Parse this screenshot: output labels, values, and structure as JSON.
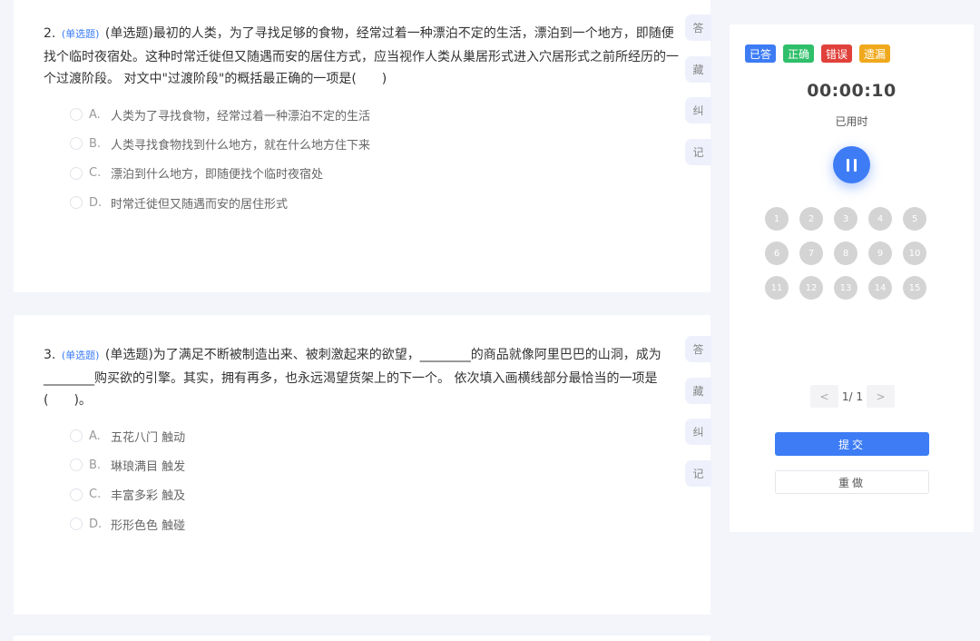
{
  "questions": [
    {
      "num": "2.",
      "type": "(单选题)",
      "text": "(单选题)最初的人类，为了寻找足够的食物，经常过着一种漂泊不定的生活，漂泊到一个地方，即随便找个临时夜宿处。这种时常迁徙但又随遇而安的居住方式，应当视作人类从巢居形式进入穴居形式之前所经历的一个过渡阶段。 对文中\"过渡阶段\"的概括最正确的一项是(　　)",
      "options": [
        {
          "letter": "A.",
          "text": "人类为了寻找食物，经常过着一种漂泊不定的生活"
        },
        {
          "letter": "B.",
          "text": "人类寻找食物找到什么地方，就在什么地方住下来"
        },
        {
          "letter": "C.",
          "text": "漂泊到什么地方，即随便找个临时夜宿处"
        },
        {
          "letter": "D.",
          "text": "时常迁徙但又随遇而安的居住形式"
        }
      ],
      "side": [
        "答",
        "藏",
        "纠",
        "记"
      ]
    },
    {
      "num": "3.",
      "type": "(单选题)",
      "text": "(单选题)为了满足不断被制造出来、被刺激起来的欲望，________的商品就像阿里巴巴的山洞，成为________购买欲的引擎。其实，拥有再多，也永远渴望货架上的下一个。 依次填入画横线部分最恰当的一项是(　　)。",
      "options": [
        {
          "letter": "A.",
          "text": "五花八门 触动"
        },
        {
          "letter": "B.",
          "text": "琳琅满目 触发"
        },
        {
          "letter": "C.",
          "text": "丰富多彩 触及"
        },
        {
          "letter": "D.",
          "text": "形形色色 触碰"
        }
      ],
      "side": [
        "答",
        "藏",
        "纠",
        "记"
      ]
    }
  ],
  "panel": {
    "legend": [
      {
        "label": "已答",
        "color": "#3d7cf5"
      },
      {
        "label": "正确",
        "color": "#2fbf6a"
      },
      {
        "label": "错误",
        "color": "#e0413a"
      },
      {
        "label": "遗漏",
        "color": "#f0a91c"
      }
    ],
    "timer": "00:00:10",
    "timer_label": "已用时",
    "pause_icon": "pause-icon",
    "numbers": [
      "1",
      "2",
      "3",
      "4",
      "5",
      "6",
      "7",
      "8",
      "9",
      "10",
      "11",
      "12",
      "13",
      "14",
      "15"
    ],
    "pager": {
      "prev": "<",
      "text": "1/ 1",
      "next": ">"
    },
    "submit_label": "提交",
    "redo_label": "重做"
  }
}
